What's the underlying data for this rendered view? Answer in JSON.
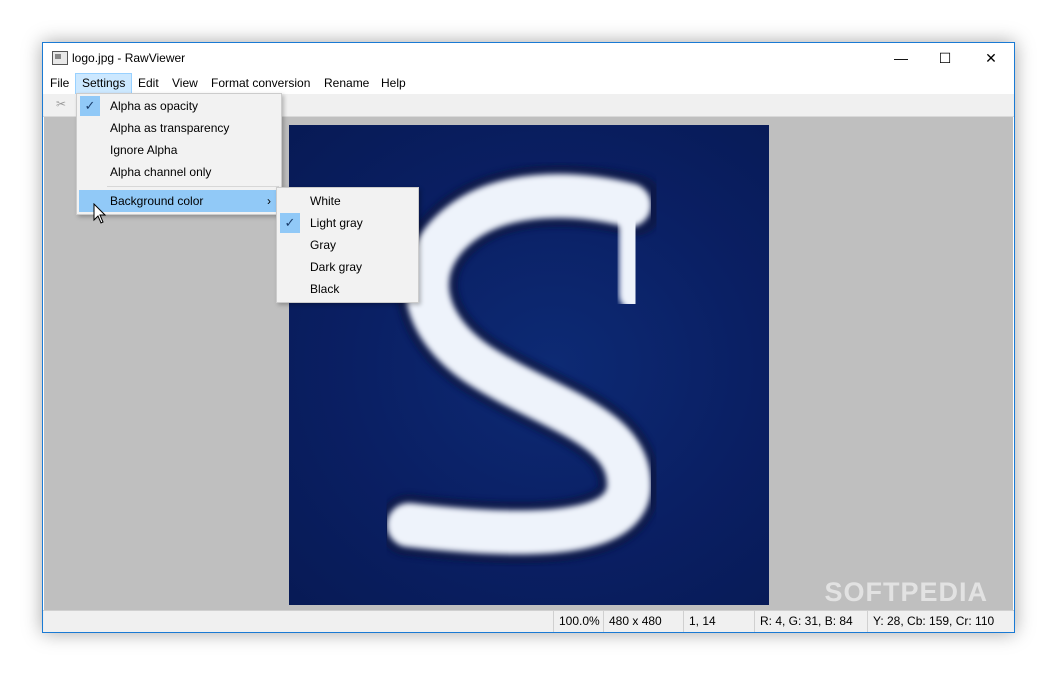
{
  "window": {
    "title": "logo.jpg - RawViewer",
    "controls": {
      "minimize": "—",
      "maximize": "☐",
      "close": "✕"
    }
  },
  "menubar": [
    "File",
    "Settings",
    "Edit",
    "View",
    "Format conversion",
    "Rename",
    "Help"
  ],
  "settings_menu": {
    "items": [
      {
        "label": "Alpha as opacity",
        "checked": true
      },
      {
        "label": "Alpha as transparency",
        "checked": false
      },
      {
        "label": "Ignore Alpha",
        "checked": false
      },
      {
        "label": "Alpha channel only",
        "checked": false
      }
    ],
    "submenu_label": "Background color",
    "submenu_arrow": "›"
  },
  "background_menu": {
    "items": [
      {
        "label": "White",
        "checked": false
      },
      {
        "label": "Light gray",
        "checked": true
      },
      {
        "label": "Gray",
        "checked": false
      },
      {
        "label": "Dark gray",
        "checked": false
      },
      {
        "label": "Black",
        "checked": false
      }
    ]
  },
  "check_glyph": "✓",
  "toolbar": {
    "cut_icon": "✂"
  },
  "watermark": "SOFTPEDIA",
  "status": {
    "zoom": "100.0%",
    "size": "480 x 480",
    "coords": "1, 14",
    "rgb": "R: 4, G: 31, B: 84",
    "ycbcr": "Y: 28, Cb: 159, Cr: 110"
  },
  "colors": {
    "accent": "#1a7ad4",
    "menu_highlight": "#91c9f7",
    "canvas_bg": "#bfbfbf",
    "image_bg": "#0a1f63"
  }
}
